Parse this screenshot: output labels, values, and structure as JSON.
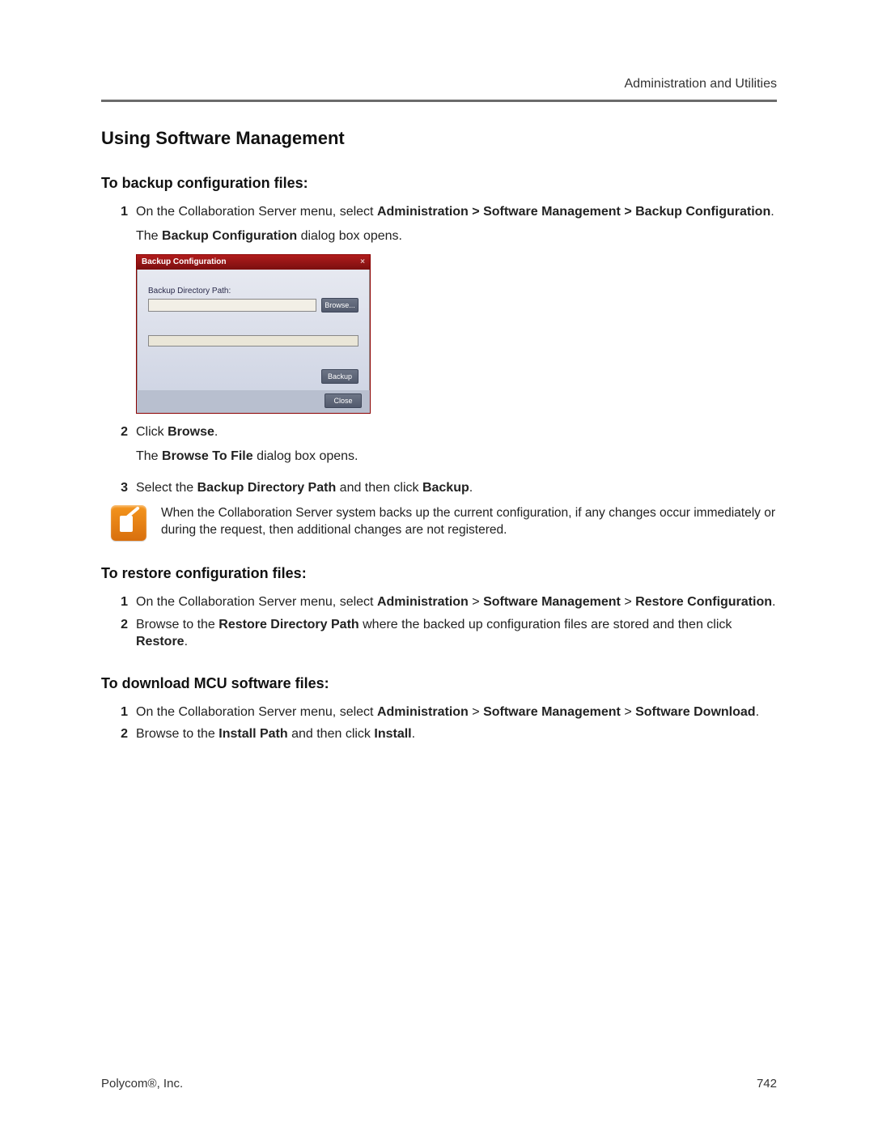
{
  "header": {
    "section": "Administration and Utilities"
  },
  "title": "Using Software Management",
  "backup": {
    "heading": "To backup configuration files:",
    "step1_pre": "On the Collaboration Server menu, select ",
    "step1_bold": "Administration > Software Management > Backup Configuration",
    "step1_post": ".",
    "step1_result_pre": "The ",
    "step1_result_bold": "Backup Configuration",
    "step1_result_post": " dialog box opens.",
    "dialog": {
      "title": "Backup Configuration",
      "label": "Backup Directory Path:",
      "browse": "Browse...",
      "backup": "Backup",
      "close": "Close"
    },
    "step2_pre": "Click ",
    "step2_bold": "Browse",
    "step2_post": ".",
    "step2_result_pre": "The ",
    "step2_result_bold": "Browse To File",
    "step2_result_post": " dialog box opens.",
    "step3_pre": "Select the ",
    "step3_bold1": "Backup Directory Path",
    "step3_mid": " and then click ",
    "step3_bold2": "Backup",
    "step3_post": ".",
    "note": "When the Collaboration Server system backs up the current configuration, if any changes occur immediately or during the request, then additional changes are not registered."
  },
  "restore": {
    "heading": "To restore configuration files:",
    "step1_pre": "On the Collaboration Server menu, select ",
    "step1_b1": "Administration",
    "s1_gt1": " > ",
    "step1_b2": "Software Management",
    "s1_gt2": " > ",
    "step1_b3": "Restore Configuration",
    "step1_post": ".",
    "step2_pre": "Browse to the ",
    "step2_b1": "Restore Directory Path",
    "step2_mid": " where the backed up configuration files are stored and then click ",
    "step2_b2": "Restore",
    "step2_post": "."
  },
  "download": {
    "heading": "To download MCU software files:",
    "step1_pre": "On the Collaboration Server menu, select ",
    "step1_b1": "Administration",
    "s1_gt1": " > ",
    "step1_b2": "Software Management",
    "s1_gt2": " > ",
    "step1_b3": "Software Download",
    "step1_post": ".",
    "step2_pre": "Browse to the ",
    "step2_b1": "Install Path",
    "step2_mid": " and then click ",
    "step2_b2": "Install",
    "step2_post": "."
  },
  "footer": {
    "company_pre": "Polycom",
    "company_reg": "®",
    "company_post": ", Inc.",
    "page": "742"
  }
}
